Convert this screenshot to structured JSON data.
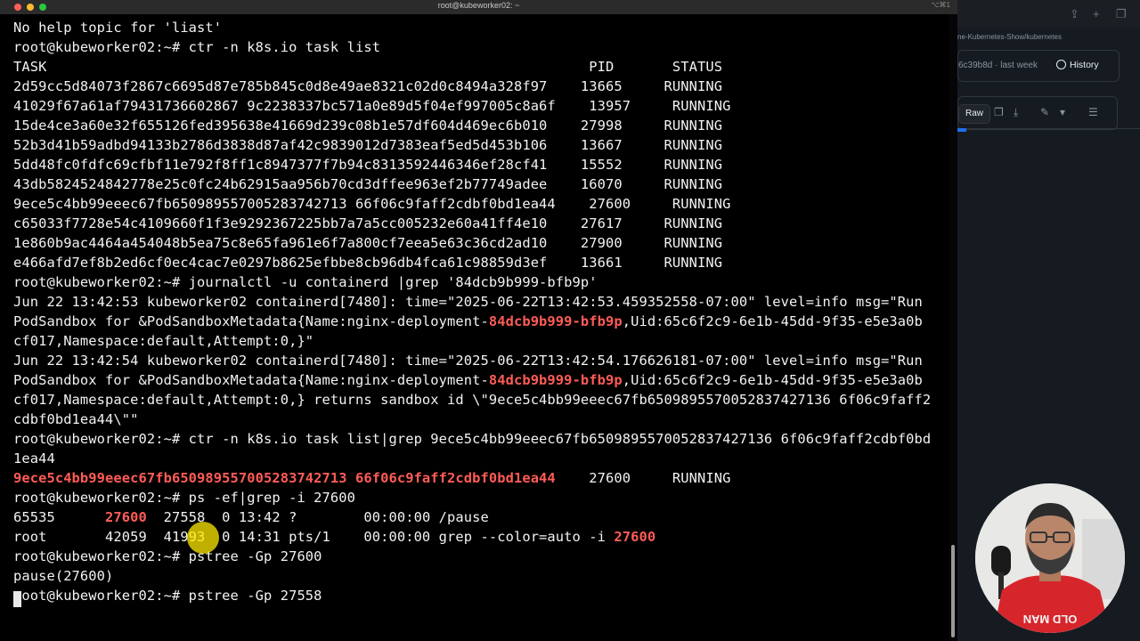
{
  "window": {
    "title": "root@kubeworker02: ~",
    "shortcut": "⌥⌘1"
  },
  "terminal": {
    "lines": [
      {
        "parts": [
          {
            "t": "No help topic for 'liast'"
          }
        ]
      },
      {
        "parts": [
          {
            "t": "root@kubeworker02:~# ctr -n k8s.io task list"
          }
        ]
      },
      {
        "parts": [
          {
            "t": "TASK                                                                 PID       STATUS"
          }
        ]
      },
      {
        "parts": [
          {
            "t": "2d59cc5d84073f2867c6695d87e785b845c0d8e49ae8321c02d0c8494a328f97    13665     RUNNING"
          }
        ]
      },
      {
        "parts": [
          {
            "t": "41029f67a61af79431736602867 9c2238337bc571a0e89d5f04ef997005c8a6f    13957     RUNNING"
          }
        ]
      },
      {
        "parts": [
          {
            "t": "15de4ce3a60e32f655126fed395638e41669d239c08b1e57df604d469ec6b010    27998     RUNNING"
          }
        ]
      },
      {
        "parts": [
          {
            "t": "52b3d41b59adbd94133b2786d3838d87af42c9839012d7383eaf5ed5d453b106    13667     RUNNING"
          }
        ]
      },
      {
        "parts": [
          {
            "t": "5dd48fc0fdfc69cfbf11e792f8ff1c8947377f7b94c8313592446346ef28cf41    15552     RUNNING"
          }
        ]
      },
      {
        "parts": [
          {
            "t": "43db5824524842778e25c0fc24b62915aa956b70cd3dffee963ef2b77749adee    16070     RUNNING"
          }
        ]
      },
      {
        "parts": [
          {
            "t": "9ece5c4bb99eeec67fb650989557005283742713 66f06c9faff2cdbf0bd1ea44    27600     RUNNING"
          }
        ]
      },
      {
        "parts": [
          {
            "t": "c65033f7728e54c4109660f1f3e9292367225bb7a7a5cc005232e60a41ff4e10    27617     RUNNING"
          }
        ]
      },
      {
        "parts": [
          {
            "t": "1e860b9ac4464a454048b5ea75c8e65fa961e6f7a800cf7eea5e63c36cd2ad10    27900     RUNNING"
          }
        ]
      },
      {
        "parts": [
          {
            "t": "e466afd7ef8b2ed6cf0ec4cac7e0297b8625efbbe8cb96db4fca61c98859d3ef    13661     RUNNING"
          }
        ]
      },
      {
        "parts": [
          {
            "t": "root@kubeworker02:~# journalctl -u containerd |grep '84dcb9b999-bfb9p'"
          }
        ]
      },
      {
        "parts": [
          {
            "t": "Jun 22 13:42:53 kubeworker02 containerd[7480]: time=\"2025-06-22T13:42:53.459352558-07:00\" level=info msg=\"Run"
          }
        ]
      },
      {
        "parts": [
          {
            "t": "PodSandbox for &PodSandboxMetadata{Name:nginx-deployment-"
          },
          {
            "t": "84dcb9b999-bfb9p",
            "c": "red"
          },
          {
            "t": ",Uid:65c6f2c9-6e1b-45dd-9f35-e5e3a0b"
          }
        ]
      },
      {
        "parts": [
          {
            "t": "cf017,Namespace:default,Attempt:0,}\""
          }
        ]
      },
      {
        "parts": [
          {
            "t": "Jun 22 13:42:54 kubeworker02 containerd[7480]: time=\"2025-06-22T13:42:54.176626181-07:00\" level=info msg=\"Run"
          }
        ]
      },
      {
        "parts": [
          {
            "t": "PodSandbox for &PodSandboxMetadata{Name:nginx-deployment-"
          },
          {
            "t": "84dcb9b999-bfb9p",
            "c": "red"
          },
          {
            "t": ",Uid:65c6f2c9-6e1b-45dd-9f35-e5e3a0b"
          }
        ]
      },
      {
        "parts": [
          {
            "t": "cf017,Namespace:default,Attempt:0,} returns sandbox id \\\"9ece5c4bb99eeec67fb6509895570052837427136 6f06c9faff2"
          }
        ]
      },
      {
        "parts": [
          {
            "t": "cdbf0bd1ea44\\\"\""
          }
        ]
      },
      {
        "parts": [
          {
            "t": "root@kubeworker02:~# ctr -n k8s.io task list|grep 9ece5c4bb99eeec67fb6509895570052837427136 6f06c9faff2cdbf0bd"
          }
        ]
      },
      {
        "parts": [
          {
            "t": "1ea44"
          }
        ]
      },
      {
        "parts": [
          {
            "t": "9ece5c4bb99eeec67fb650989557005283742713 66f06c9faff2cdbf0bd1ea44",
            "c": "red"
          },
          {
            "t": "    27600     RUNNING"
          }
        ]
      },
      {
        "parts": [
          {
            "t": "root@kubeworker02:~# ps -ef|grep -i 27600"
          }
        ]
      },
      {
        "parts": [
          {
            "t": "65535      "
          },
          {
            "t": "27600",
            "c": "red"
          },
          {
            "t": "  27558  0 13:42 ?        00:00:00 /pause"
          }
        ]
      },
      {
        "parts": [
          {
            "t": "root       42059  41993  0 14:31 pts/1    00:00:00 grep --color=auto -i "
          },
          {
            "t": "27600",
            "c": "red"
          }
        ]
      },
      {
        "parts": [
          {
            "t": "root@kubeworker02:~# pstree -Gp 27600"
          }
        ]
      },
      {
        "parts": [
          {
            "t": "pause(27600)"
          }
        ]
      },
      {
        "parts": [
          {
            "t": "root@kubeworker02:~# pstree -Gp 27558"
          }
        ]
      }
    ]
  },
  "colors": {
    "background": "#000000",
    "text": "#f2f2f2",
    "match_red": "#ff5c57",
    "accent_blue": "#1f6feb"
  },
  "github_panel": {
    "path": "ne-Kubernetes-Show/kubernetes",
    "commit": "6c39b8d · last week",
    "history_label": "History",
    "raw_label": "Raw",
    "icons": [
      "share-icon",
      "plus-icon",
      "copy-icon",
      "copy-icon",
      "download-icon",
      "pencil-icon",
      "chevron-down-icon",
      "list-icon",
      "history-icon"
    ]
  },
  "webcam": {
    "shirt_text": "OLD MAN"
  }
}
